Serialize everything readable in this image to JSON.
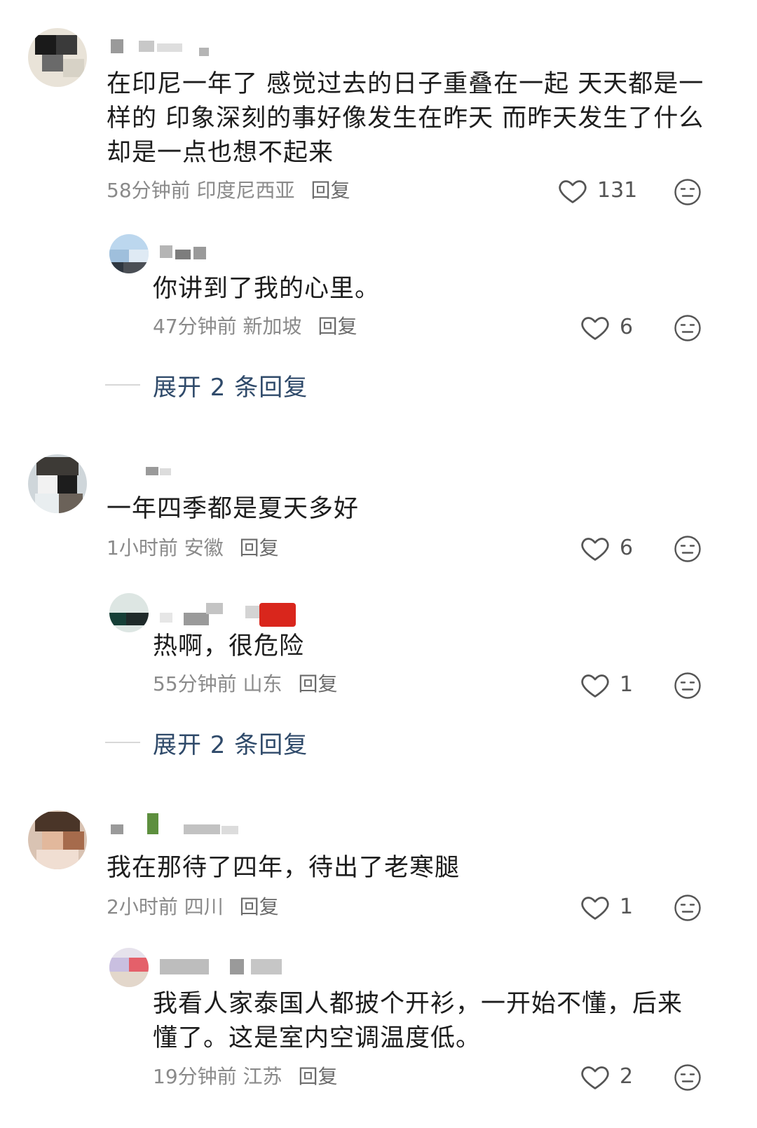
{
  "comments": [
    {
      "text": "在印尼一年了 感觉过去的日子重叠在一起 天天都是一样的 印象深刻的事好像发生在昨天 而昨天发生了什么却是一点也想不起来",
      "time": "58分钟前",
      "location": "印度尼西亚",
      "reply_label": "回复",
      "likes": "131",
      "reply": {
        "text": "你讲到了我的心里。",
        "time": "47分钟前",
        "location": "新加坡",
        "reply_label": "回复",
        "likes": "6"
      },
      "expand_label": "展开 2 条回复"
    },
    {
      "text": "一年四季都是夏天多好",
      "time": "1小时前",
      "location": "安徽",
      "reply_label": "回复",
      "likes": "6",
      "reply": {
        "text": "热啊，很危险",
        "time": "55分钟前",
        "location": "山东",
        "reply_label": "回复",
        "likes": "1"
      },
      "expand_label": "展开 2 条回复"
    },
    {
      "text": "我在那待了四年，待出了老寒腿",
      "time": "2小时前",
      "location": "四川",
      "reply_label": "回复",
      "likes": "1",
      "reply": {
        "text": "我看人家泰国人都披个开衫，一开始不懂，后来懂了。这是室内空调温度低。",
        "time": "19分钟前",
        "location": "江苏",
        "reply_label": "回复",
        "likes": "2"
      }
    }
  ]
}
